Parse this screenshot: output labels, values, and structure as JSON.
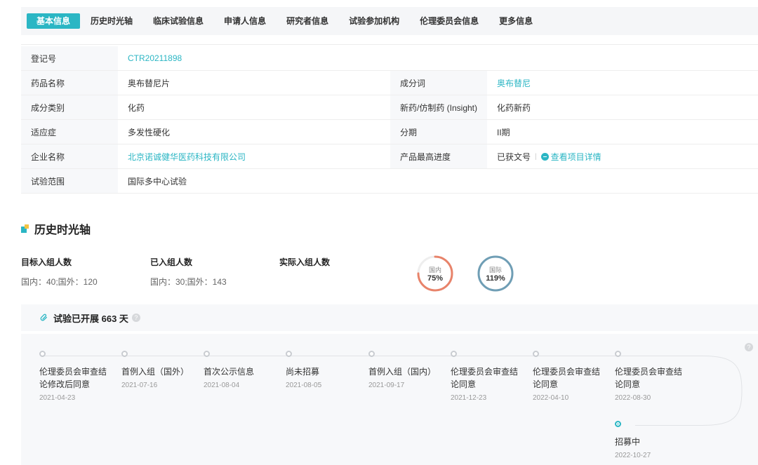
{
  "tabs": [
    "基本信息",
    "历史时光轴",
    "临床试验信息",
    "申请人信息",
    "研究者信息",
    "试验参加机构",
    "伦理委员会信息",
    "更多信息"
  ],
  "info": {
    "reg_no_label": "登记号",
    "reg_no_value": "CTR20211898",
    "drug_name_label": "药品名称",
    "drug_name_value": "奥布替尼片",
    "ingredient_label": "成分词",
    "ingredient_value": "奥布替尼",
    "category_label": "成分类别",
    "category_value": "化药",
    "new_generic_label": "新药/仿制药 (Insight)",
    "new_generic_value": "化药新药",
    "indication_label": "适应症",
    "indication_value": "多发性硬化",
    "phase_label": "分期",
    "phase_value": "II期",
    "company_label": "企业名称",
    "company_value": "北京诺诚健华医药科技有限公司",
    "progress_label": "产品最高进度",
    "progress_value": "已获文号",
    "project_detail_link": "查看项目详情",
    "scope_label": "试验范围",
    "scope_value": "国际多中心试验"
  },
  "timeline_section": {
    "title": "历史时光轴",
    "target_label": "目标入组人数",
    "target_value": "国内：40;国外：120",
    "enrolled_label": "已入组人数",
    "enrolled_value": "国内：30;国外：143",
    "actual_label": "实际入组人数",
    "rings": [
      {
        "label": "国内",
        "value": "75%",
        "fraction": 0.75,
        "color": "#e8836a"
      },
      {
        "label": "国际",
        "value": "119%",
        "fraction": 1.0,
        "color": "#6f9eb5"
      }
    ],
    "duration_text": "试验已开展 663 天",
    "help": "?"
  },
  "timeline": [
    {
      "name": "伦理委员会审查结论修改后同意",
      "date": "2021-04-23"
    },
    {
      "name": "首例入组（国外）",
      "date": "2021-07-16"
    },
    {
      "name": "首次公示信息",
      "date": "2021-08-04"
    },
    {
      "name": "尚未招募",
      "date": "2021-08-05"
    },
    {
      "name": "首例入组（国内）",
      "date": "2021-09-17"
    },
    {
      "name": "伦理委员会审查结论同意",
      "date": "2021-12-23"
    },
    {
      "name": "伦理委员会审查结论同意",
      "date": "2022-04-10"
    },
    {
      "name": "伦理委员会审查结论同意",
      "date": "2022-08-30"
    },
    {
      "name": "招募中",
      "date": "2022-10-27"
    }
  ],
  "colors": {
    "accent": "#2bb6c4",
    "domestic_ring": "#e8836a",
    "intl_ring": "#6f9eb5"
  }
}
